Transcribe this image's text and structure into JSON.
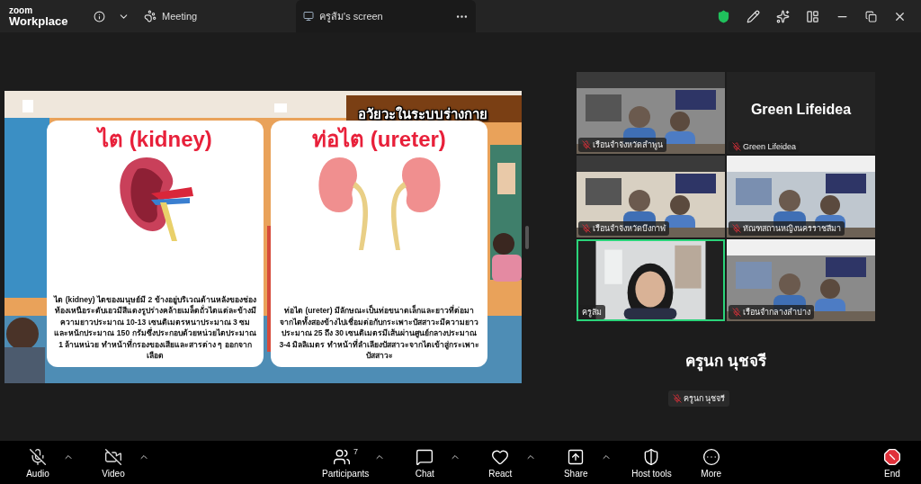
{
  "app": {
    "brand_top": "zoom",
    "brand_bottom": "Workplace",
    "meeting_label": "Meeting",
    "share_tab": "ครูส้ม's screen"
  },
  "slide": {
    "header": "อวัยวะในระบบร่างกาย",
    "cards": [
      {
        "kind": "kidney",
        "title": "ไต (kidney)",
        "body": "ไต (kidney) ไตของมนุษย์มี 2 ข้างอยู่บริเวณด้านหลังของช่องท้องเหนือระดับเอวมีสีแดงรูปร่างคล้ายเมล็ดถั่วไตแต่ละข้างมีความยาวประมาณ 10-13 เซนติเมตรหนาประมาณ 3 ซมและหนักประมาณ 150 กรัมซึ่งประกอบด้วยหน่วยไตประมาณ 1 ล้านหน่วย ทำหน้าที่กรองของเสียและสารต่าง ๆ ออกจากเลือด"
      },
      {
        "kind": "ureter",
        "title": "ท่อไต (ureter)",
        "body": "ท่อไต (ureter) มีลักษณะเป็นท่อขนาดเล็กและยาวที่ต่อมาจากไตทั้งสองข้างไปเชื่อมต่อกับกระเพาะปัสสาวะมีความยาวประมาณ 25 ถึง 30 เซนติเมตรมีเส้นผ่านศูนย์กลางประมาณ 3-4 มิลลิเมตร ทำหน้าที่ลำเลียงปัสสาวะจากไตเข้าสู่กระเพาะปัสสาวะ"
      }
    ]
  },
  "gallery": [
    {
      "kind": "video",
      "name": "เรือนจำจังหวัดลำพูน",
      "muted": true,
      "speaking": false
    },
    {
      "kind": "name",
      "display": "Green Lifeidea",
      "name": "Green Lifeidea",
      "muted": true,
      "speaking": false
    },
    {
      "kind": "video",
      "name": "เรือนจำจังหวัดบึงกาฬ",
      "muted": true,
      "speaking": false
    },
    {
      "kind": "video",
      "name": "ทัณฑสถานหญิงนครราชสีมา",
      "muted": true,
      "speaking": false
    },
    {
      "kind": "video",
      "name": "ครูส้ม",
      "muted": false,
      "speaking": true
    },
    {
      "kind": "video",
      "name": "เรือนจำกลางลำปาง",
      "muted": true,
      "speaking": false
    }
  ],
  "spotlight": {
    "display": "ครูนก นุชจรี",
    "name": "ครูนก นุชจรี",
    "muted": true
  },
  "toolbar": [
    {
      "kind": "audio",
      "label": "Audio",
      "muted": true,
      "has_menu": true
    },
    {
      "kind": "video",
      "label": "Video",
      "muted": true,
      "has_menu": true
    },
    {
      "kind": "participants",
      "label": "Participants",
      "count": "7",
      "has_menu": true
    },
    {
      "kind": "chat",
      "label": "Chat",
      "has_menu": true
    },
    {
      "kind": "react",
      "label": "React",
      "has_menu": true
    },
    {
      "kind": "share",
      "label": "Share",
      "has_menu": true
    },
    {
      "kind": "host",
      "label": "Host tools",
      "has_menu": false
    },
    {
      "kind": "more",
      "label": "More",
      "has_menu": false
    },
    {
      "kind": "end",
      "label": "End",
      "has_menu": false
    }
  ]
}
